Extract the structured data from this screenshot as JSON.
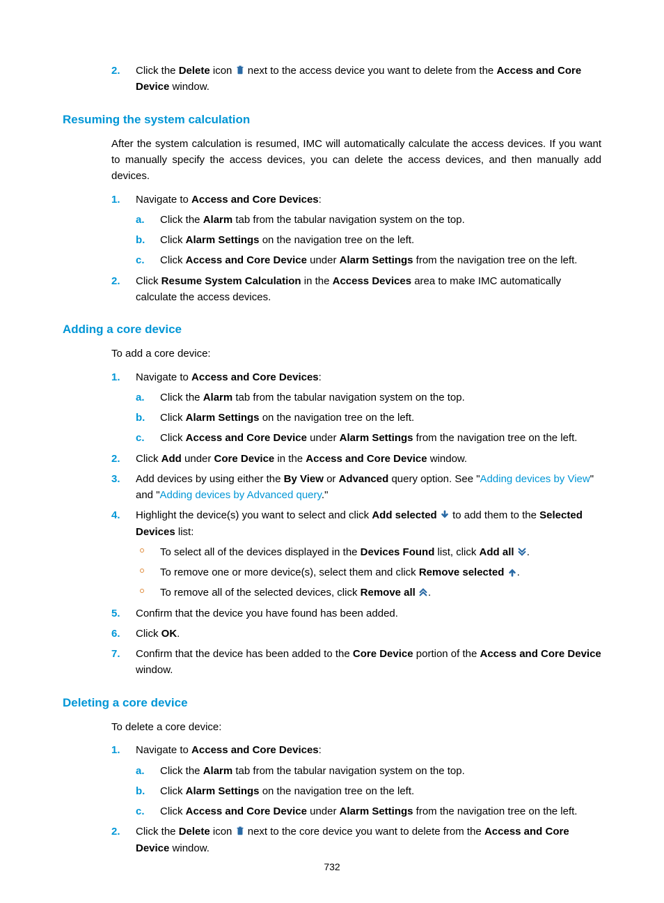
{
  "pageNumber": "732",
  "top": {
    "step2_a": "Click the ",
    "step2_b": "Delete",
    "step2_c": " icon ",
    "step2_d": " next to the access device you want to delete from the ",
    "step2_e": "Access and Core Device",
    "step2_f": " window."
  },
  "section1": {
    "heading": "Resuming the system calculation",
    "intro": "After the system calculation is resumed, IMC will automatically calculate the access devices. If you want to manually specify the access devices, you can delete the access devices, and then manually add devices.",
    "n1": "Navigate to ",
    "n1b": "Access and Core Devices",
    "a1": "Click the ",
    "a1b": "Alarm",
    "a1c": " tab from the tabular navigation system on the top.",
    "b1": "Click ",
    "b1b": "Alarm Settings",
    "b1c": " on the navigation tree on the left.",
    "c1": "Click ",
    "c1b": "Access and Core Device",
    "c1c": " under ",
    "c1d": "Alarm Settings",
    "c1e": " from the navigation tree on the left.",
    "n2a": "Click ",
    "n2b": "Resume System Calculation",
    "n2c": " in the ",
    "n2d": "Access Devices",
    "n2e": " area to make IMC automatically calculate the access devices."
  },
  "section2": {
    "heading": "Adding a core device",
    "intro": "To add a core device:",
    "n2a": "Click ",
    "n2b": "Add",
    "n2c": " under ",
    "n2d": "Core Device",
    "n2e": " in the ",
    "n2f": "Access and Core Device",
    "n2g": " window.",
    "n3a": "Add devices by using either the ",
    "n3b": "By View",
    "n3c": " or ",
    "n3d": "Advanced",
    "n3e": " query option. See \"",
    "n3link1": "Adding devices by View",
    "n3f": "\" and \"",
    "n3link2": "Adding devices by Advanced query",
    "n3g": ".\"",
    "n4a": "Highlight the device(s) you want to select and click ",
    "n4b": "Add selected",
    "n4c": " to add them to the ",
    "n4d": "Selected Devices",
    "n4e": " list:",
    "bul1a": "To select all of the devices displayed in the ",
    "bul1b": "Devices Found",
    "bul1c": " list, click ",
    "bul1d": "Add all",
    "bul2a": "To remove one or more device(s), select them and click ",
    "bul2b": "Remove selected",
    "bul3a": "To remove all of the selected devices, click ",
    "bul3b": "Remove all",
    "n5": "Confirm that the device you have found has been added.",
    "n6a": "Click ",
    "n6b": "OK",
    "n7a": "Confirm that the device has been added to the ",
    "n7b": "Core Device",
    "n7c": " portion of the ",
    "n7d": "Access and Core Device",
    "n7e": " window."
  },
  "section3": {
    "heading": "Deleting a core device",
    "intro": "To delete a core device:",
    "n2a": "Click the ",
    "n2b": "Delete",
    "n2c": " icon ",
    "n2d": " next to the core device you want to delete from the ",
    "n2e": "Access and Core Device",
    "n2f": " window."
  },
  "markers": {
    "m1": "1.",
    "m2": "2.",
    "m3": "3.",
    "m4": "4.",
    "m5": "5.",
    "m6": "6.",
    "m7": "7.",
    "a": "a.",
    "b": "b.",
    "c": "c."
  }
}
